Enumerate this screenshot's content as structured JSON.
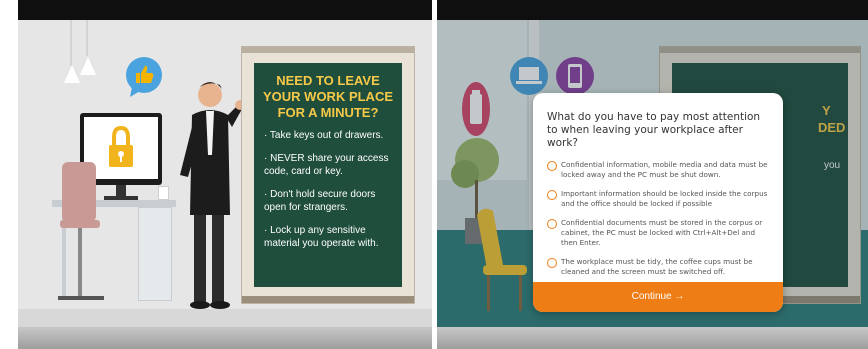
{
  "left_slide": {
    "board": {
      "title": "NEED TO LEAVE YOUR WORK PLACE FOR A MINUTE?",
      "items": [
        "· Take keys out of drawers.",
        "· NEVER share your access code, card or key.",
        "· Don't hold secure doors open for strangers.",
        "· Lock up any sensitive material you operate with."
      ]
    }
  },
  "right_slide": {
    "board_fragments": [
      "Y",
      "DED",
      "you"
    ],
    "question": {
      "text": "What do you have to pay most attention to when leaving your workplace after work?",
      "options": [
        "Confidential information, mobile media and data must be locked away and the PC must be shut down.",
        "Important information should be locked inside the corpus and the office should be locked if possible",
        "Confidential documents must be stored in the corpus or cabinet, the PC must be locked with Ctrl+Alt+Del and then Enter.",
        "The workplace must be tidy, the coffee cups must be cleaned and the screen must be switched off."
      ],
      "continue_label": "Continue →"
    }
  },
  "colors": {
    "board_green": "#1f4e3d",
    "board_title": "#f7c948",
    "accent_orange": "#ef7d15"
  },
  "icons": [
    "thumbs-up-icon",
    "padlock-icon",
    "usb-drive-icon",
    "laptop-icon",
    "mobile-phone-icon"
  ]
}
